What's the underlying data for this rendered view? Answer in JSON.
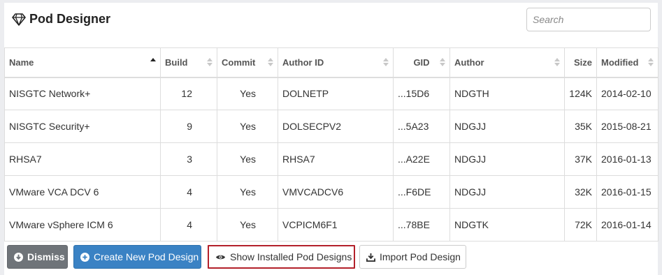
{
  "header": {
    "title": "Pod Designer",
    "title_icon": "diamond-icon",
    "search_placeholder": "Search"
  },
  "table": {
    "columns": [
      {
        "key": "name",
        "label": "Name",
        "sort": "asc"
      },
      {
        "key": "build",
        "label": "Build",
        "sort": "none"
      },
      {
        "key": "commit",
        "label": "Commit",
        "sort": "none"
      },
      {
        "key": "author_id",
        "label": "Author ID",
        "sort": "none"
      },
      {
        "key": "gid",
        "label": "GID",
        "sort": "none"
      },
      {
        "key": "author",
        "label": "Author",
        "sort": "none"
      },
      {
        "key": "size",
        "label": "Size",
        "sort": "none"
      },
      {
        "key": "modified",
        "label": "Modified",
        "sort": "none"
      }
    ],
    "rows": [
      {
        "name": "NISGTC Network+",
        "build": "12",
        "commit": "Yes",
        "author_id": "DOLNETP",
        "gid": "...15D6",
        "author": "NDGTH",
        "size": "124K",
        "modified": "2014-02-10"
      },
      {
        "name": "NISGTC Security+",
        "build": "9",
        "commit": "Yes",
        "author_id": "DOLSECPV2",
        "gid": "...5A23",
        "author": "NDGJJ",
        "size": "35K",
        "modified": "2015-08-21"
      },
      {
        "name": "RHSA7",
        "build": "3",
        "commit": "Yes",
        "author_id": "RHSA7",
        "gid": "...A22E",
        "author": "NDGJJ",
        "size": "37K",
        "modified": "2016-01-13"
      },
      {
        "name": "VMware VCA DCV 6",
        "build": "4",
        "commit": "Yes",
        "author_id": "VMVCADCV6",
        "gid": "...F6DE",
        "author": "NDGJJ",
        "size": "32K",
        "modified": "2016-01-15"
      },
      {
        "name": "VMware vSphere ICM 6",
        "build": "4",
        "commit": "Yes",
        "author_id": "VCPICM6F1",
        "gid": "...78BE",
        "author": "NDGTK",
        "size": "72K",
        "modified": "2016-01-14"
      }
    ]
  },
  "footer": {
    "dismiss_label": "Dismiss",
    "create_label": "Create New Pod Design",
    "show_installed_label": "Show Installed Pod Designs",
    "import_label": "Import Pod Design"
  },
  "colors": {
    "primary": "#3a82c4",
    "secondary": "#6f7479",
    "highlight_border": "#b3202a"
  }
}
